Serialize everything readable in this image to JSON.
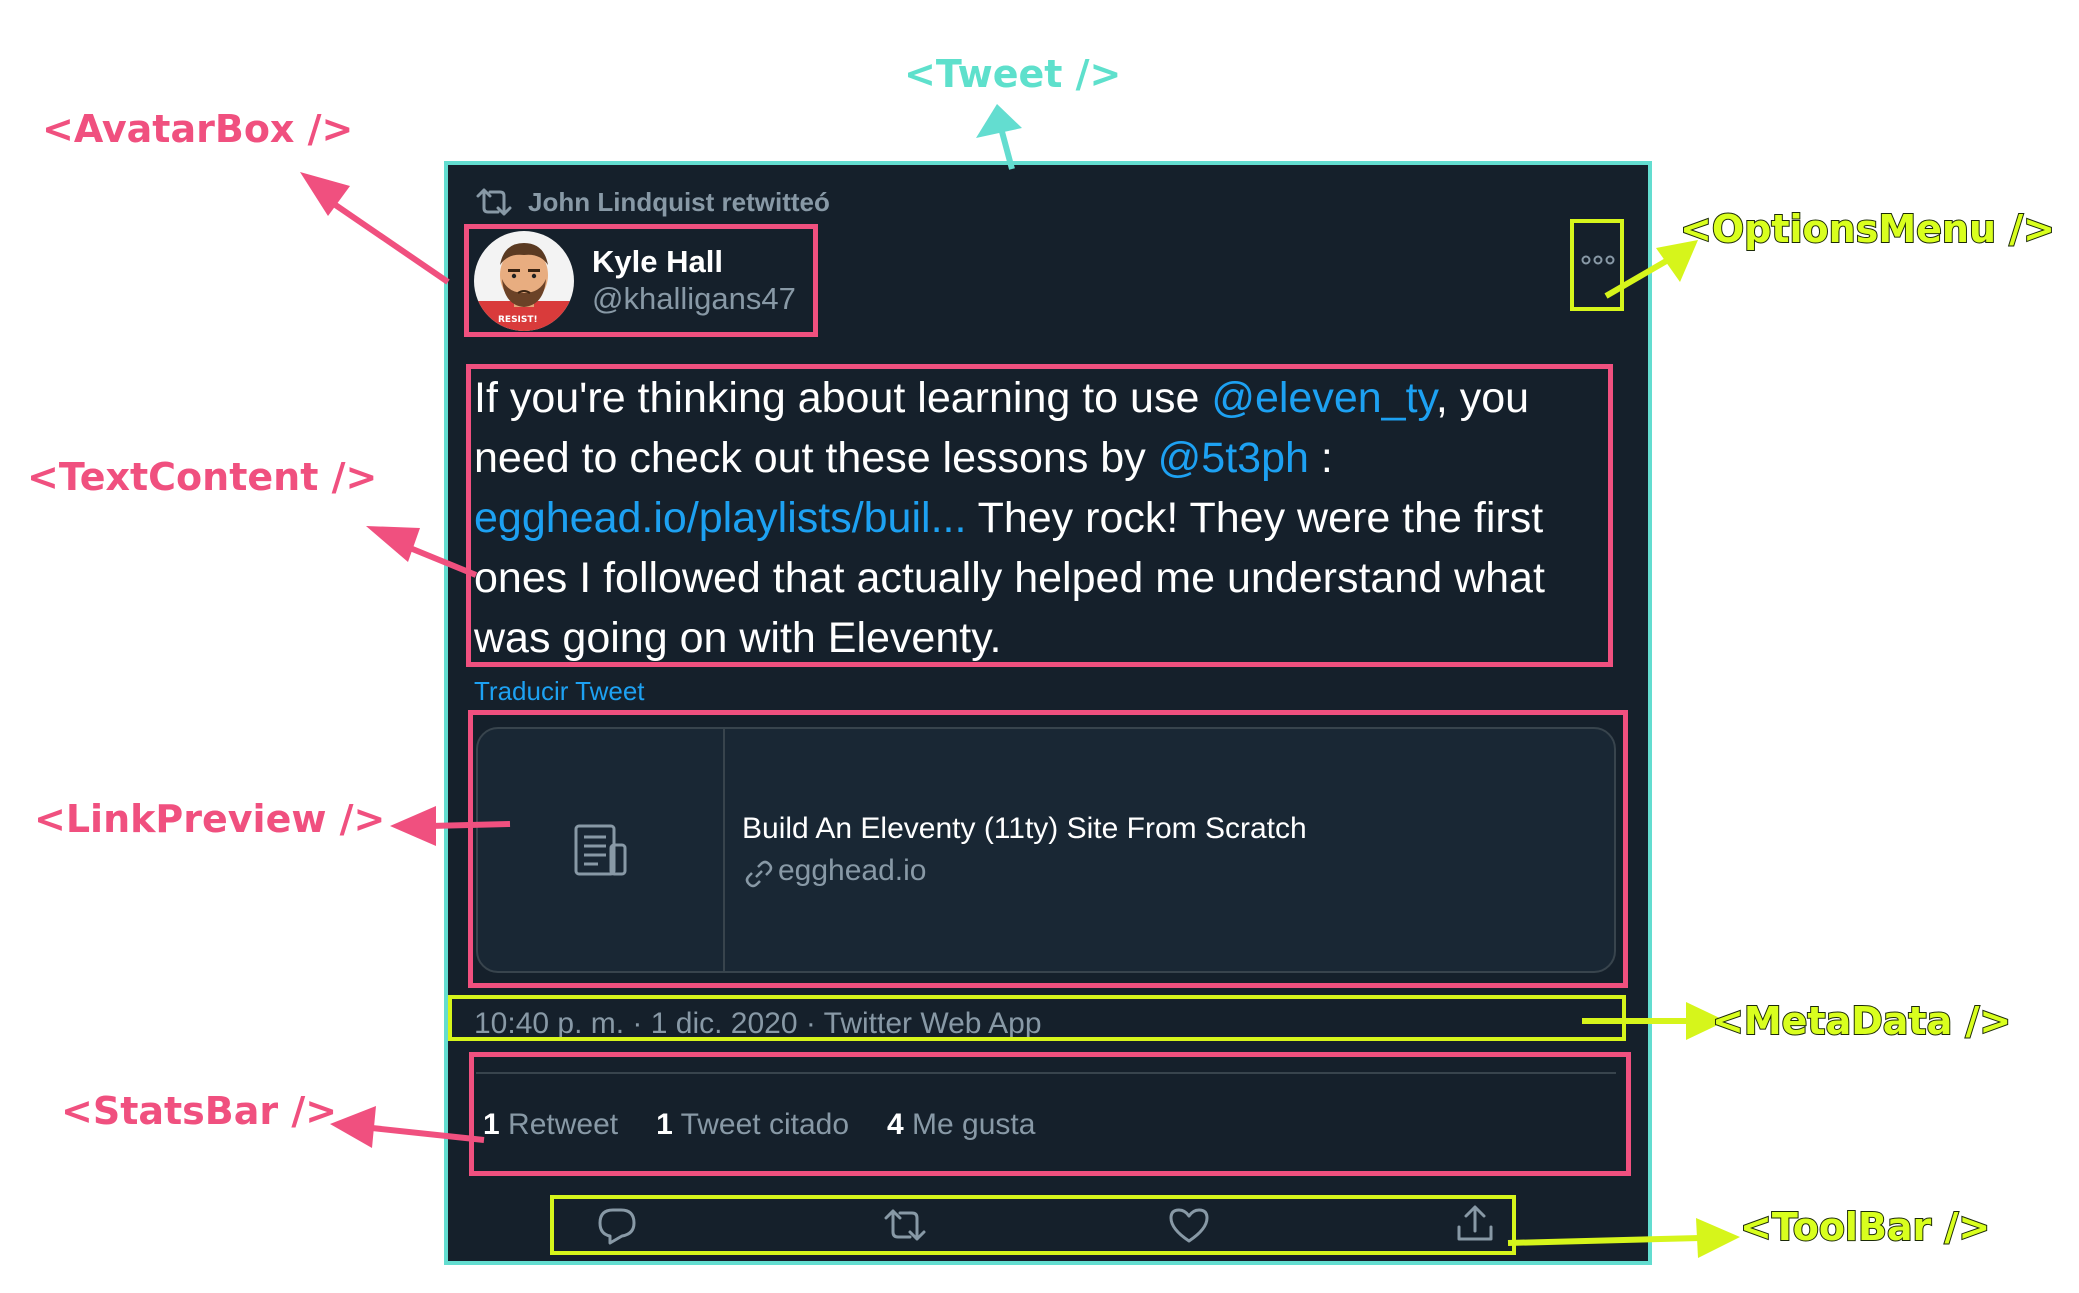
{
  "labels": {
    "tweet": "<Tweet />",
    "avatar_box": "<AvatarBox />",
    "text_content": "<TextContent />",
    "link_preview": "<LinkPreview />",
    "stats_bar": "<StatsBar />",
    "options_menu": "<OptionsMenu />",
    "meta_data": "<MetaData />",
    "tool_bar": "<ToolBar />"
  },
  "tweet": {
    "retweet_line": "John Lindquist retwitteó",
    "author_name": "Kyle Hall",
    "author_handle": "@khalligans47",
    "avatar_badge": "RESIST!",
    "text": {
      "t1": "If you're thinking about learning to use ",
      "mention1": "@eleven_ty",
      "t2": ", you need to check out these lessons by ",
      "mention2": "@5t3ph",
      "t3": " : ",
      "link": "egghead.io/playlists/buil...",
      "t4": " They rock! They were the first ones I followed that actually helped me understand what was going on with Eleventy."
    },
    "translate": "Traducir Tweet",
    "card": {
      "title": "Build An Eleventy (11ty) Site From Scratch",
      "domain": "egghead.io"
    },
    "meta": "10:40 p. m. · 1 dic. 2020 · Twitter Web App",
    "stats": {
      "retweets": "1",
      "retweets_label": "Retweet",
      "quotes": "1",
      "quotes_label": "Tweet citado",
      "likes": "4",
      "likes_label": "Me gusta"
    }
  },
  "colors": {
    "pink": "#f0507f",
    "teal": "#63ddd0",
    "lime": "#d6f51b",
    "card_bg": "#15202b",
    "link_blue": "#1da1f2",
    "muted": "#8899a6"
  },
  "icons": [
    "retweet-icon",
    "more-options-icon",
    "article-icon",
    "link-icon",
    "reply-icon",
    "like-icon",
    "share-icon"
  ]
}
